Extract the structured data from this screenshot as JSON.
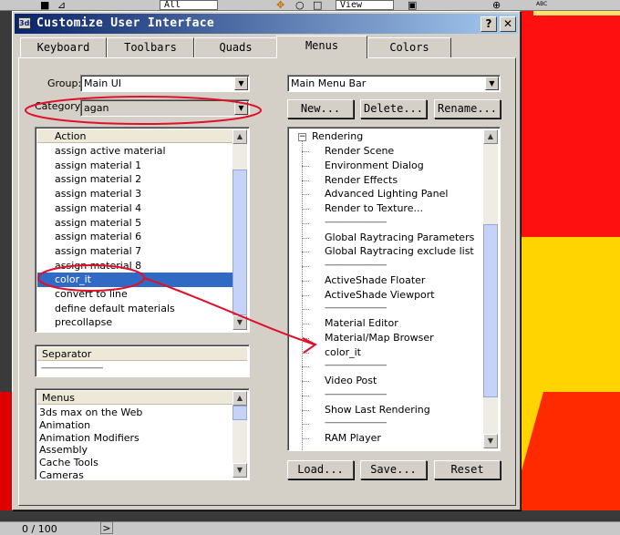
{
  "toolbar": {
    "filter_value": "All",
    "view_value": "View",
    "right_icon_label": "ABC"
  },
  "dialog": {
    "title": "Customize User Interface",
    "help_label": "?",
    "close_label": "✕"
  },
  "tabs": [
    {
      "label": "Keyboard",
      "active": false
    },
    {
      "label": "Toolbars",
      "active": false
    },
    {
      "label": "Quads",
      "active": false
    },
    {
      "label": "Menus",
      "active": true
    },
    {
      "label": "Colors",
      "active": false
    }
  ],
  "left": {
    "group_label": "Group:",
    "group_value": "Main UI",
    "category_label": "Category:",
    "category_value": "agan",
    "actions_header": "Action",
    "actions": [
      "assign active material",
      "assign material 1",
      "assign material 2",
      "assign material 3",
      "assign material 4",
      "assign material 5",
      "assign material 6",
      "assign material 7",
      "assign material 8",
      "color_it",
      "convert to line",
      "define default materials",
      "precollapse"
    ],
    "actions_selected_index": 9,
    "separator_header": "Separator",
    "separator_item": "------------------------------",
    "menus_header": "Menus",
    "menus": [
      "3ds max on the Web",
      "Animation",
      "Animation Modifiers",
      "Assembly",
      "Cache Tools",
      "Cameras"
    ]
  },
  "right": {
    "menu_bar_value": "Main Menu Bar",
    "new_label": "New...",
    "delete_label": "Delete...",
    "rename_label": "Rename...",
    "tree_root": "Rendering",
    "tree_expander": "−",
    "tree_items": [
      {
        "text": "Render Scene",
        "sep": false
      },
      {
        "text": "Environment Dialog",
        "sep": false
      },
      {
        "text": "Render Effects",
        "sep": false
      },
      {
        "text": "Advanced Lighting Panel",
        "sep": false
      },
      {
        "text": "Render to Texture...",
        "sep": false
      },
      {
        "text": "------------------------------",
        "sep": true
      },
      {
        "text": "Global Raytracing Parameters",
        "sep": false
      },
      {
        "text": "Global Raytracing exclude list",
        "sep": false
      },
      {
        "text": "------------------------------",
        "sep": true
      },
      {
        "text": "ActiveShade Floater",
        "sep": false
      },
      {
        "text": "ActiveShade Viewport",
        "sep": false
      },
      {
        "text": "------------------------------",
        "sep": true
      },
      {
        "text": "Material Editor",
        "sep": false
      },
      {
        "text": "Material/Map Browser",
        "sep": false
      },
      {
        "text": "color_it",
        "sep": false
      },
      {
        "text": "------------------------------",
        "sep": true
      },
      {
        "text": "Video Post",
        "sep": false
      },
      {
        "text": "------------------------------",
        "sep": true
      },
      {
        "text": "Show Last Rendering",
        "sep": false
      },
      {
        "text": "------------------------------",
        "sep": true
      },
      {
        "text": "RAM Player",
        "sep": false
      }
    ],
    "load_label": "Load...",
    "save_label": "Save...",
    "reset_label": "Reset"
  },
  "status": {
    "frame_counter": "0 / 100",
    "nav_arrow": ">"
  },
  "annotation_color": "#e0102a"
}
